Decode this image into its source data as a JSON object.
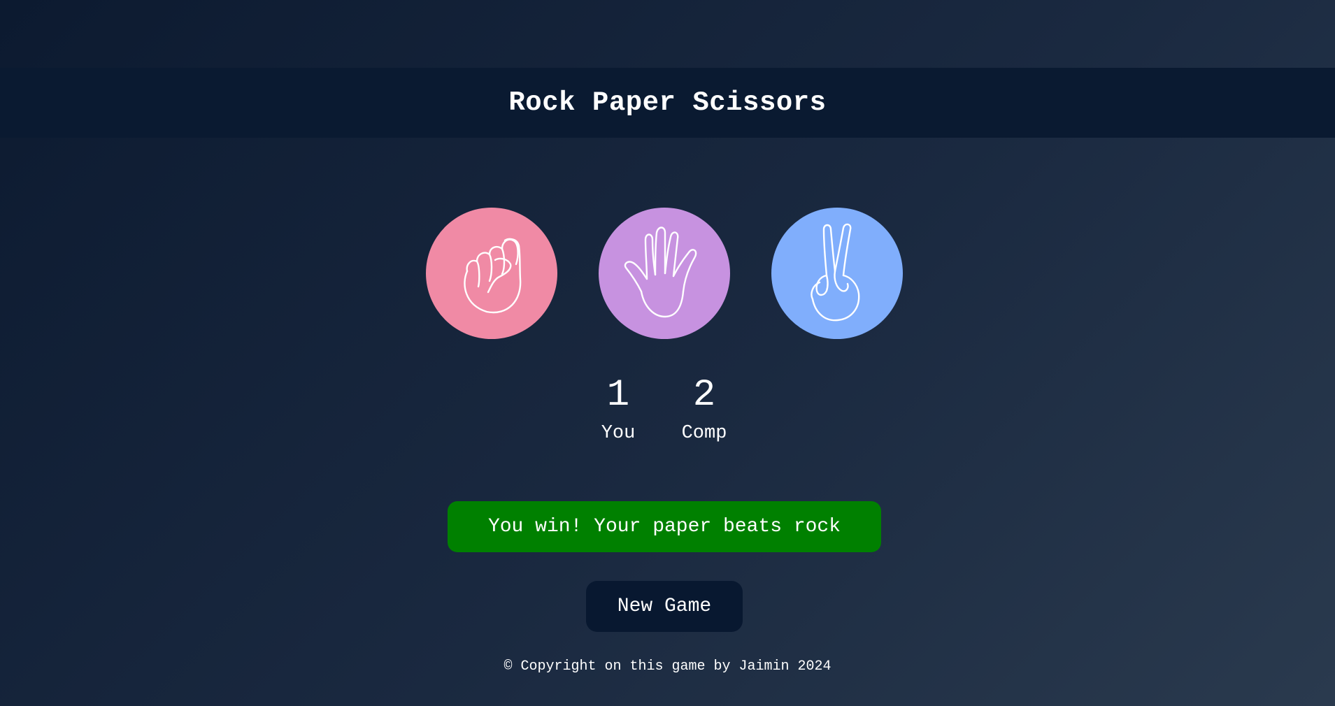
{
  "header": {
    "title": "Rock Paper Scissors"
  },
  "choices": [
    {
      "name": "rock",
      "icon": "rock-fist-icon",
      "color": "#f08aa5"
    },
    {
      "name": "paper",
      "icon": "paper-open-hand-icon",
      "color": "#c792e0"
    },
    {
      "name": "scissors",
      "icon": "scissors-peace-hand-icon",
      "color": "#80aefc"
    }
  ],
  "scoreboard": {
    "user_score": "1",
    "user_label": "You",
    "comp_score": "2",
    "comp_label": "Comp"
  },
  "message": {
    "text": "You win! Your paper beats rock",
    "color": "#008000"
  },
  "new_game": {
    "label": "New Game"
  },
  "footer": {
    "text": "© Copyright on this game by Jaimin 2024"
  },
  "colors": {
    "header_bg": "#0a1a31",
    "button_bg": "#081830",
    "win_green": "#008000"
  }
}
